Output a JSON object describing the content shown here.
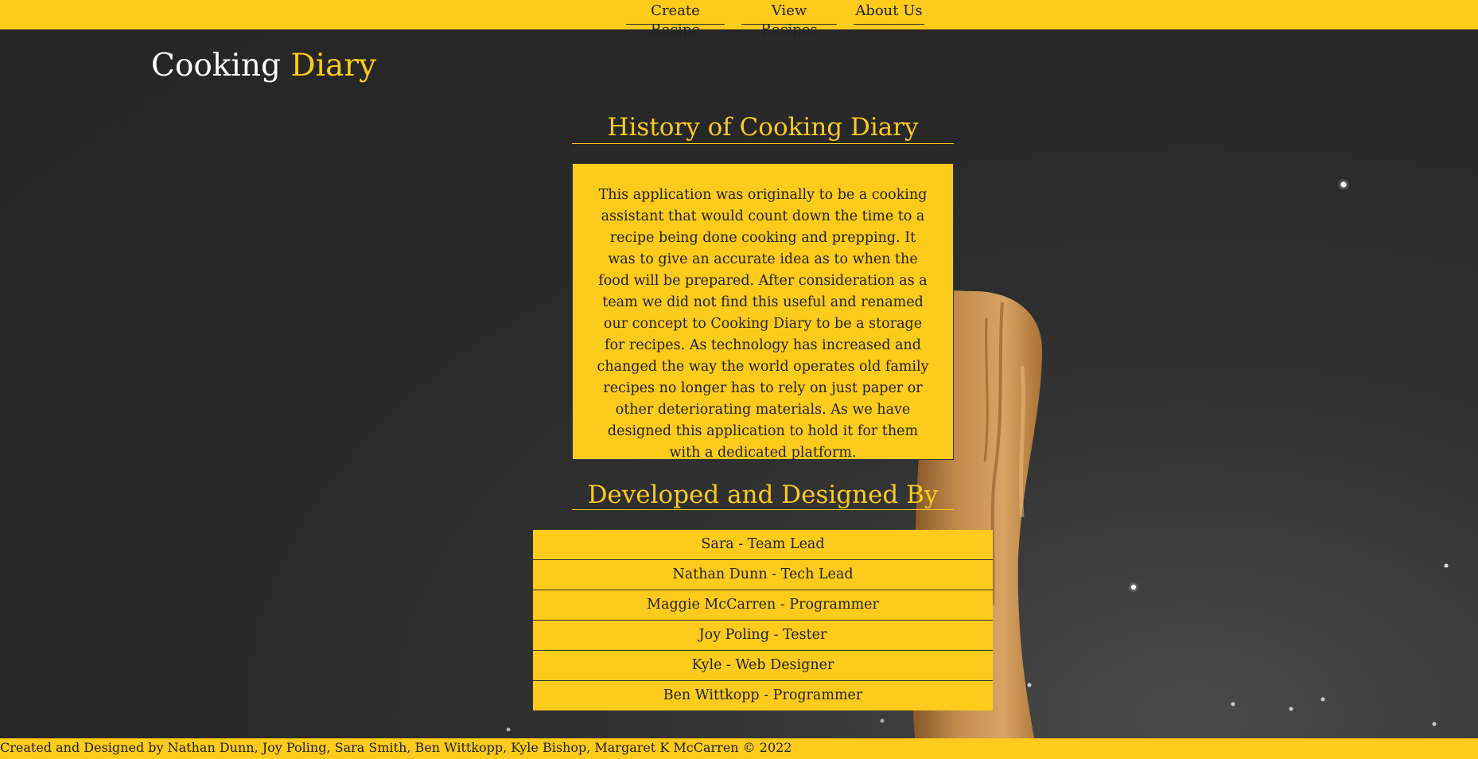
{
  "nav": {
    "items": [
      {
        "label": "Create Recipe"
      },
      {
        "label": "View Recipes"
      },
      {
        "label": "About Us"
      }
    ]
  },
  "header": {
    "title_part1": "Cooking",
    "title_part2": "Diary"
  },
  "history": {
    "heading": "History of Cooking Diary",
    "body": "This application was originally to be a cooking assistant that would count down the time to a recipe being done cooking and prepping. It was to give an accurate idea as to when the food will be prepared. After consideration as a team we did not find this useful and renamed our concept to Cooking Diary to be a storage for recipes. As technology has increased and changed the way the world operates old family recipes no longer has to rely on just paper or other deteriorating materials. As we have designed this application to hold it for them with a dedicated platform."
  },
  "team": {
    "heading": "Developed and Designed By",
    "members": [
      "Sara - Team Lead",
      "Nathan Dunn - Tech Lead",
      "Maggie McCarren - Programmer",
      "Joy Poling - Tester",
      "Kyle - Web Designer",
      "Ben Wittkopp - Programmer"
    ]
  },
  "footer": {
    "text": "Created and Designed by Nathan Dunn, Joy Poling, Sara Smith, Ben Wittkopp, Kyle Bishop, Margaret K McCarren © 2022"
  },
  "colors": {
    "accent": "#fdcb1b",
    "background": "#282828",
    "text_dark": "#222222",
    "text_light": "#ffffff"
  }
}
